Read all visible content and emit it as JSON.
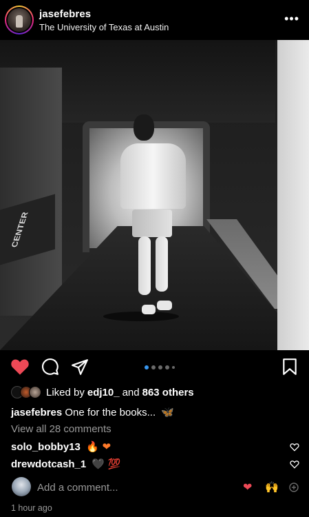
{
  "post": {
    "username": "jasefebres",
    "location": "The University of Texas at Austin",
    "more_label": "•••",
    "image_banner_text": "CENTER"
  },
  "carousel": {
    "count": 5,
    "active_index": 0
  },
  "likes": {
    "prefix": "Liked by",
    "user": "edj10_",
    "middle": "and",
    "others": "863 others"
  },
  "caption": {
    "username": "jasefebres",
    "text": "One for the books...",
    "emoji": "🦋"
  },
  "view_all_label": "View all 28 comments",
  "comments": [
    {
      "username": "solo_bobby13",
      "text": "🔥 ❤"
    },
    {
      "username": "drewdotcash_1",
      "text": "🖤 💯"
    }
  ],
  "add_comment": {
    "placeholder": "Add a comment...",
    "quick1": "❤",
    "quick2": "🙌"
  },
  "timestamp": "1 hour ago",
  "colors": {
    "like_red": "#ed4956",
    "active_dot": "#3897f0",
    "muted": "#9a9a9a"
  },
  "icons": [
    "more-icon",
    "heart-icon",
    "comment-icon",
    "share-icon",
    "save-icon",
    "small-heart-icon",
    "plus-icon"
  ]
}
